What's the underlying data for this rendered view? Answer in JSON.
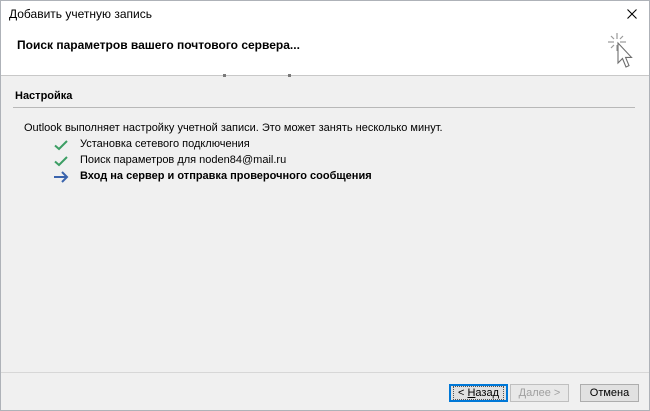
{
  "window": {
    "title": "Добавить учетную запись",
    "close_icon": "close-icon"
  },
  "header": {
    "heading": "Поиск параметров вашего почтового сервера...",
    "icon": "wizard-sparkle-cursor-icon"
  },
  "section": {
    "title": "Настройка",
    "status": "Outlook выполняет настройку учетной записи. Это может занять несколько минут."
  },
  "steps": [
    {
      "label": "Установка сетевого подключения",
      "state": "done",
      "icon": "checkmark-icon"
    },
    {
      "label": "Поиск параметров для noden84@mail.ru",
      "state": "done",
      "icon": "checkmark-icon"
    },
    {
      "label": "Вход на сервер и отправка проверочного сообщения",
      "state": "in-progress",
      "icon": "arrow-right-icon"
    }
  ],
  "buttons": {
    "back": {
      "prefix": "< ",
      "accel": "Н",
      "rest": "азад",
      "enabled": true,
      "default": true
    },
    "next": {
      "label": "Далее >",
      "enabled": false
    },
    "cancel": {
      "label": "Отмена",
      "enabled": true
    }
  },
  "colors": {
    "check": "#3c9e64",
    "arrow": "#3a64ad",
    "accent": "#0078d7"
  }
}
